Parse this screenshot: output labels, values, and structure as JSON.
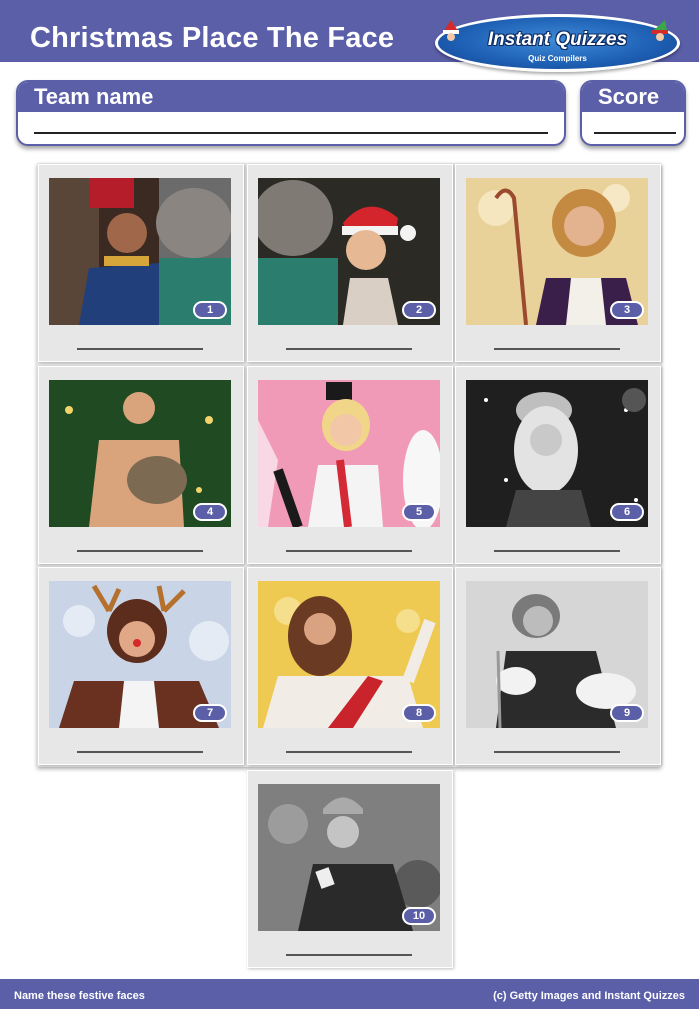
{
  "header": {
    "title": "Christmas Place The Face",
    "logo": {
      "name": "Instant Quizzes",
      "tagline": "Quiz Compilers"
    }
  },
  "fields": {
    "team_label": "Team name",
    "score_label": "Score"
  },
  "photos": [
    {
      "number": "1",
      "subject": "nutcracker-soldier-with-mouse-king"
    },
    {
      "number": "2",
      "subject": "woman-in-santa-hat-with-mouse-king"
    },
    {
      "number": "3",
      "subject": "man-in-wig-with-shepherd-crook"
    },
    {
      "number": "4",
      "subject": "man-holding-cat-by-christmas-tree"
    },
    {
      "number": "5",
      "subject": "woman-in-candy-cane-costume"
    },
    {
      "number": "6",
      "subject": "woman-in-santa-hat-in-snow"
    },
    {
      "number": "7",
      "subject": "man-in-reindeer-costume"
    },
    {
      "number": "8",
      "subject": "man-dressed-as-biblical-figure"
    },
    {
      "number": "9",
      "subject": "woman-in-santa-outfit-black-and-white"
    },
    {
      "number": "10",
      "subject": "man-in-helmet-and-cape-black-and-white"
    }
  ],
  "footer": {
    "left": "Name these festive faces",
    "right": "(c) Getty Images and Instant Quizzes"
  },
  "colors": {
    "brand": "#5b5fa8",
    "cell_bg": "#e7e7e7"
  }
}
